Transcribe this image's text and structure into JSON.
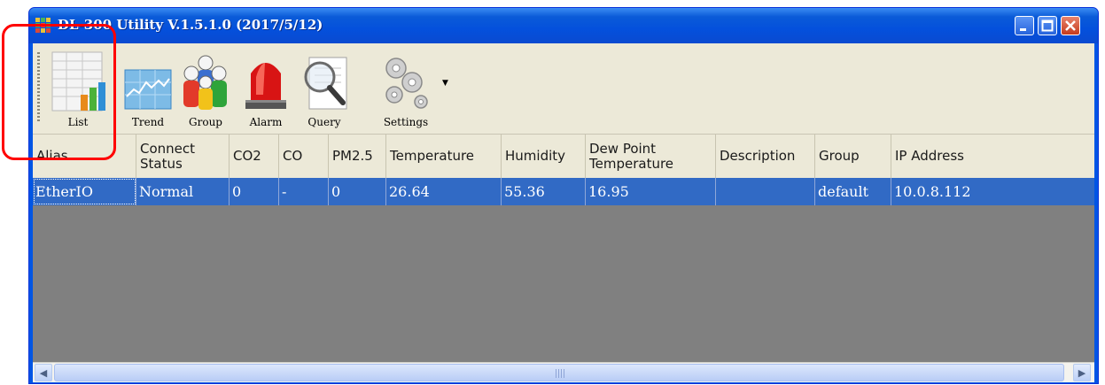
{
  "window": {
    "title": "DL-300 Utility V.1.5.1.0 (2017/5/12)"
  },
  "toolbar": {
    "items": [
      {
        "label": "List",
        "icon": "list-report-icon"
      },
      {
        "label": "Trend",
        "icon": "trend-chart-icon"
      },
      {
        "label": "Group",
        "icon": "group-people-icon"
      },
      {
        "label": "Alarm",
        "icon": "alarm-beacon-icon"
      },
      {
        "label": "Query",
        "icon": "query-magnifier-icon"
      },
      {
        "label": "Settings",
        "icon": "settings-gears-icon"
      }
    ]
  },
  "table": {
    "columns": [
      "Alias",
      "Connect\nStatus",
      "CO2",
      "CO",
      "PM2.5",
      "Temperature",
      "Humidity",
      "Dew Point\nTemperature",
      "Description",
      "Group",
      "IP Address"
    ],
    "rows": [
      [
        "EtherIO",
        "Normal",
        "0",
        "-",
        "0",
        "26.64",
        "55.36",
        "16.95",
        "",
        "default",
        "10.0.8.112"
      ]
    ]
  },
  "colors": {
    "title_bar": "#0a5bd8",
    "selected_row": "#316ac5",
    "grid_background": "#808080",
    "toolbar_background": "#ece9d8",
    "highlight_box": "#ff0000"
  }
}
